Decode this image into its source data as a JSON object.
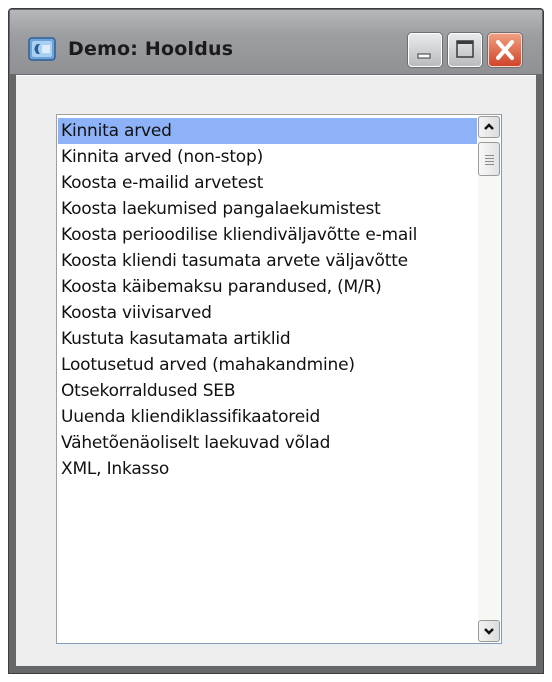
{
  "window": {
    "title": "Demo: Hooldus",
    "icon": "app-icon",
    "controls": [
      "minimize-icon",
      "maximize-icon",
      "close-icon"
    ]
  },
  "list": {
    "selected_index": 0,
    "items": [
      "Kinnita arved",
      "Kinnita arved (non-stop)",
      "Koosta e-mailid arvetest",
      "Koosta laekumised pangalaekumistest",
      "Koosta perioodilise kliendiväljavõtte e-mail",
      "Koosta kliendi tasumata arvete väljavõtte",
      "Koosta käibemaksu parandused, (M/R)",
      "Koosta viivisarved",
      "Kustuta kasutamata artiklid",
      "Lootusetud arved (mahakandmine)",
      "Otsekorraldused SEB",
      "Uuenda kliendiklassifikaatoreid",
      "Vähetõenäoliselt laekuvad võlad",
      "XML, Inkasso"
    ]
  },
  "colors": {
    "selection": "#8db2f7",
    "title_bar": "#9c9ea2",
    "close_button": "#d0442a"
  }
}
